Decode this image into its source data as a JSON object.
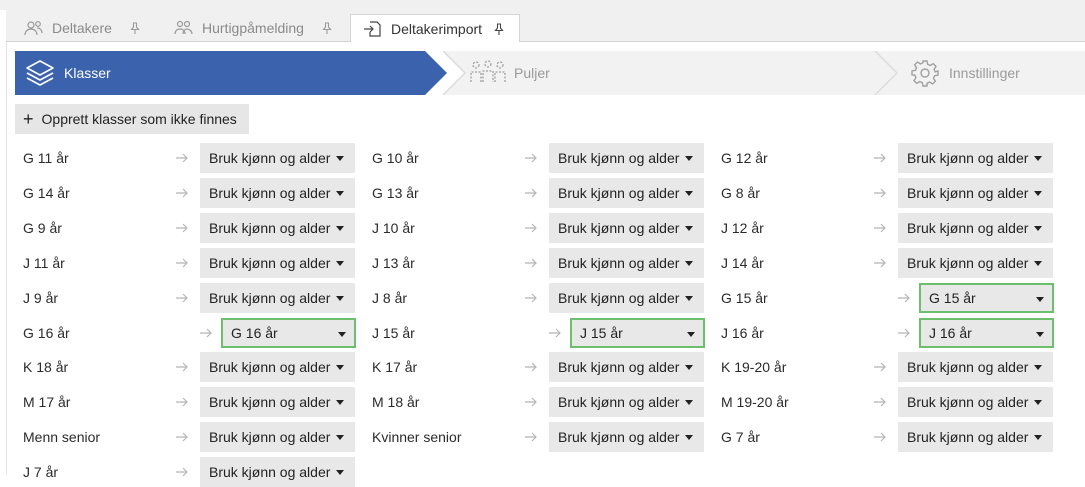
{
  "tabs": [
    {
      "label": "Deltakere",
      "icon": "people-icon",
      "active": false
    },
    {
      "label": "Hurtigpåmelding",
      "icon": "people-group-icon",
      "active": false
    },
    {
      "label": "Deltakerimport",
      "icon": "import-icon",
      "active": true
    }
  ],
  "wizard": {
    "steps": [
      {
        "label": "Klasser",
        "icon": "layers-icon",
        "active": true
      },
      {
        "label": "Puljer",
        "icon": "group-icon",
        "active": false
      },
      {
        "label": "Innstillinger",
        "icon": "gear-icon",
        "active": false
      }
    ],
    "accent": "#3b63ad"
  },
  "create_button": {
    "label": "Opprett klasser som ikke finnes",
    "icon": "plus-icon"
  },
  "default_option": "Bruk kjønn og alder",
  "columns": [
    [
      {
        "name": "G 11 år",
        "value": "Bruk kjønn og alder",
        "set": false
      },
      {
        "name": "G 14 år",
        "value": "Bruk kjønn og alder",
        "set": false
      },
      {
        "name": "G 9 år",
        "value": "Bruk kjønn og alder",
        "set": false
      },
      {
        "name": "J 11 år",
        "value": "Bruk kjønn og alder",
        "set": false
      },
      {
        "name": "J 9 år",
        "value": "Bruk kjønn og alder",
        "set": false
      },
      {
        "name": "G 16 år",
        "value": "G 16 år",
        "set": true
      },
      {
        "name": "K 18 år",
        "value": "Bruk kjønn og alder",
        "set": false
      },
      {
        "name": "M 17 år",
        "value": "Bruk kjønn og alder",
        "set": false
      },
      {
        "name": "Menn senior",
        "value": "Bruk kjønn og alder",
        "set": false
      },
      {
        "name": "J 7 år",
        "value": "Bruk kjønn og alder",
        "set": false
      }
    ],
    [
      {
        "name": "G 10 år",
        "value": "Bruk kjønn og alder",
        "set": false
      },
      {
        "name": "G 13 år",
        "value": "Bruk kjønn og alder",
        "set": false
      },
      {
        "name": "J 10 år",
        "value": "Bruk kjønn og alder",
        "set": false
      },
      {
        "name": "J 13 år",
        "value": "Bruk kjønn og alder",
        "set": false
      },
      {
        "name": "J 8 år",
        "value": "Bruk kjønn og alder",
        "set": false
      },
      {
        "name": "J 15 år",
        "value": "J 15 år",
        "set": true
      },
      {
        "name": "K 17 år",
        "value": "Bruk kjønn og alder",
        "set": false
      },
      {
        "name": "M 18 år",
        "value": "Bruk kjønn og alder",
        "set": false
      },
      {
        "name": "Kvinner senior",
        "value": "Bruk kjønn og alder",
        "set": false
      }
    ],
    [
      {
        "name": "G 12 år",
        "value": "Bruk kjønn og alder",
        "set": false
      },
      {
        "name": "G 8 år",
        "value": "Bruk kjønn og alder",
        "set": false
      },
      {
        "name": "J 12 år",
        "value": "Bruk kjønn og alder",
        "set": false
      },
      {
        "name": "J 14 år",
        "value": "Bruk kjønn og alder",
        "set": false
      },
      {
        "name": "G 15 år",
        "value": "G 15 år",
        "set": true
      },
      {
        "name": "J 16 år",
        "value": "J 16 år",
        "set": true
      },
      {
        "name": "K 19-20 år",
        "value": "Bruk kjønn og alder",
        "set": false
      },
      {
        "name": "M 19-20 år",
        "value": "Bruk kjønn og alder",
        "set": false
      },
      {
        "name": "G 7 år",
        "value": "Bruk kjønn og alder",
        "set": false
      }
    ]
  ]
}
